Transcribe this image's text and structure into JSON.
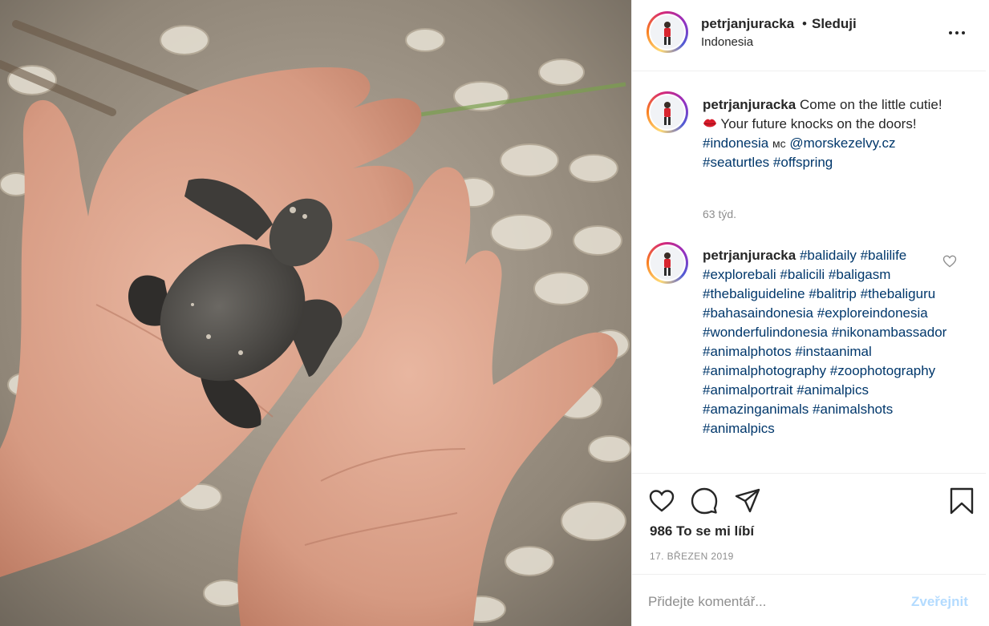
{
  "post": {
    "username": "petrjanjuracka",
    "separator": "•",
    "follow_label": "Sleduji",
    "location": "Indonesia",
    "more_icon": "more-options-icon"
  },
  "caption": {
    "username": "petrjanjuracka",
    "text_before_emoji": "Come on the little cutie!",
    "emoji_icon": "kiss-lips-icon",
    "text_after_emoji": "Your future knocks on the doors!",
    "hashtag_1": "#indonesia",
    "text_middle": "мс",
    "mention": "@morskezelvy.cz",
    "hashtag_2": "#seaturtles",
    "hashtag_3": "#offspring",
    "time": "63 týd."
  },
  "comment": {
    "username": "petrjanjuracka",
    "hashtags": [
      "#balidaily",
      "#balilife",
      "#explorebali",
      "#balicili",
      "#baligasm",
      "#thebaliguideline",
      "#balitrip",
      "#thebaliguru",
      "#bahasaindonesia",
      "#exploreindonesia",
      "#wonderfulindonesia",
      "#nikonambassador",
      "#animalphotos",
      "#instaanimal",
      "#animalphotography",
      "#zoophotography",
      "#animalportrait",
      "#animalpics",
      "#amazinganimals",
      "#animalshots",
      "#animalpics"
    ],
    "like_icon": "heart-outline-icon"
  },
  "actions": {
    "like_icon": "heart-icon",
    "comment_icon": "comment-bubble-icon",
    "share_icon": "paper-plane-icon",
    "save_icon": "bookmark-icon"
  },
  "likes_text": "986 To se mi líbí",
  "date_text": "17. BŘEZEN 2019",
  "comment_form": {
    "placeholder": "Přidejte komentář...",
    "post_label": "Zveřejnit"
  },
  "colors": {
    "link": "#00376b",
    "muted": "#8e8e8e",
    "post_button_disabled": "#b3dbff",
    "text": "#262626"
  }
}
